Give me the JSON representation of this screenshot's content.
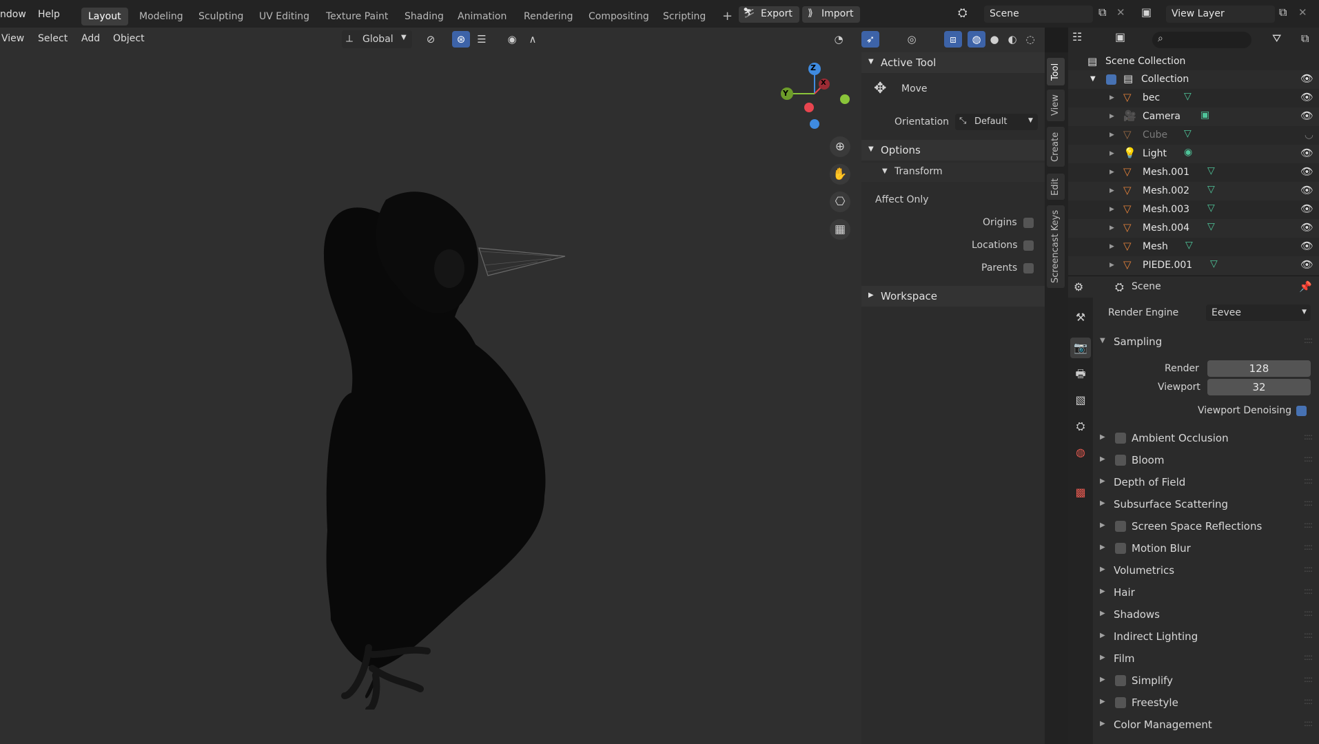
{
  "menus": {
    "window": "ndow",
    "help": "Help"
  },
  "workspaces": [
    "Layout",
    "Modeling",
    "Sculpting",
    "UV Editing",
    "Texture Paint",
    "Shading",
    "Animation",
    "Rendering",
    "Compositing",
    "Scripting"
  ],
  "add_workspace": "+",
  "export_label": "Export",
  "import_label": "Import",
  "scene_name": "Scene",
  "view_layer": "View Layer",
  "viewport_menus": [
    "View",
    "Select",
    "Add",
    "Object"
  ],
  "transform_orientation": "Global",
  "npanel": {
    "active_tool_header": "Active Tool",
    "tool_name": "Move",
    "orientation_label": "Orientation",
    "orientation_value": "Default",
    "options_header": "Options",
    "transform_header": "Transform",
    "affect_only_label": "Affect Only",
    "origins_label": "Origins",
    "locations_label": "Locations",
    "parents_label": "Parents",
    "workspace_header": "Workspace"
  },
  "side_tabs": [
    "Tool",
    "View",
    "Create",
    "Edit",
    "Screencast Keys"
  ],
  "outliner": {
    "root": "Scene Collection",
    "collection": "Collection",
    "items": [
      "bec",
      "Camera",
      "Cube",
      "Light",
      "Mesh.001",
      "Mesh.002",
      "Mesh.003",
      "Mesh.004",
      "Mesh",
      "PIEDE.001"
    ]
  },
  "properties": {
    "context": "Scene",
    "render_engine_label": "Render Engine",
    "render_engine_value": "Eevee",
    "sampling_header": "Sampling",
    "render_label": "Render",
    "render_value": "128",
    "viewport_label": "Viewport",
    "viewport_value": "32",
    "viewport_denoising_label": "Viewport Denoising",
    "sections": [
      {
        "label": "Ambient Occlusion",
        "checkbox": true
      },
      {
        "label": "Bloom",
        "checkbox": true
      },
      {
        "label": "Depth of Field",
        "checkbox": false
      },
      {
        "label": "Subsurface Scattering",
        "checkbox": false
      },
      {
        "label": "Screen Space Reflections",
        "checkbox": true
      },
      {
        "label": "Motion Blur",
        "checkbox": true
      },
      {
        "label": "Volumetrics",
        "checkbox": false
      },
      {
        "label": "Hair",
        "checkbox": false
      },
      {
        "label": "Shadows",
        "checkbox": false
      },
      {
        "label": "Indirect Lighting",
        "checkbox": false
      },
      {
        "label": "Film",
        "checkbox": false
      },
      {
        "label": "Simplify",
        "checkbox": true
      },
      {
        "label": "Freestyle",
        "checkbox": true
      },
      {
        "label": "Color Management",
        "checkbox": false
      }
    ]
  },
  "gizmo": {
    "z": "Z",
    "y": "Y",
    "x": "X"
  },
  "colors": {
    "accent": "#4772b3",
    "mesh_icon": "#e5823a",
    "data_icon": "#4fc59a",
    "axis_x": "#e8454f",
    "axis_y": "#8ac53a",
    "axis_z": "#3f8be0"
  }
}
